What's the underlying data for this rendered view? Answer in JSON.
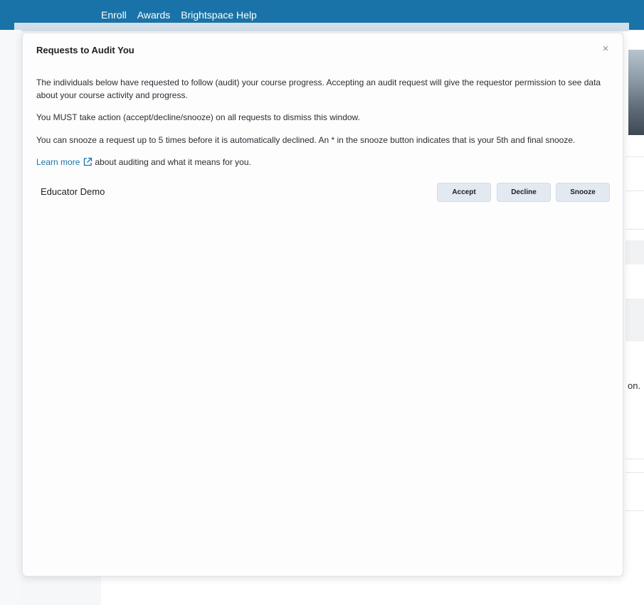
{
  "nav": {
    "items": [
      "Enroll",
      "Awards",
      "Brightspace Help"
    ]
  },
  "background": {
    "partial_text": "on."
  },
  "dialog": {
    "title": "Requests to Audit You",
    "close_symbol": "×",
    "paragraph1": "The individuals below have requested to follow (audit) your course progress. Accepting an audit request will give the requestor permission to see data about your course activity and progress.",
    "paragraph2": "You MUST take action (accept/decline/snooze) on all requests to dismiss this window.",
    "paragraph3": "You can snooze a request up to 5 times before it is automatically declined. An * in the snooze button indicates that is your 5th and final snooze.",
    "learn_more_link": "Learn more",
    "learn_more_suffix": "about auditing and what it means for you.",
    "requests": [
      {
        "name": "Educator Demo",
        "accept_label": "Accept",
        "decline_label": "Decline",
        "snooze_label": "Snooze"
      }
    ]
  },
  "colors": {
    "topbar": "#1a73a8",
    "link": "#1a73a8",
    "button_bg": "#e3e9f1"
  },
  "icons": {
    "close": "close-icon",
    "external_link": "external-link-icon"
  }
}
